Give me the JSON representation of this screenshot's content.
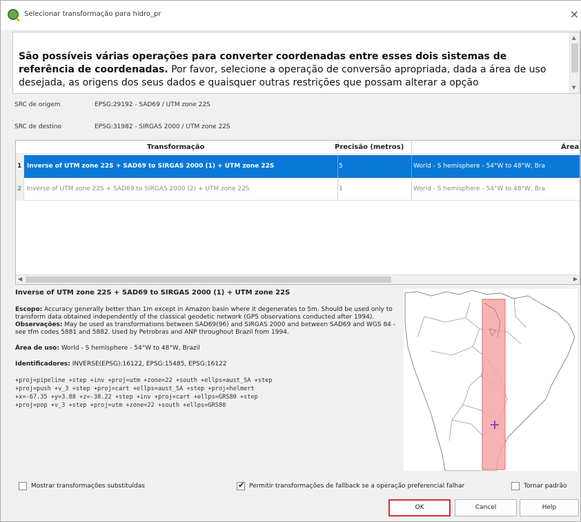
{
  "window": {
    "title": "Selecionar transformação para hidro_pr",
    "close_glyph": "×"
  },
  "message": {
    "bold_text": "São possíveis várias operações para converter coordenadas entre esses dois sistemas de referência de coordenadas.",
    "normal_text": " Por favor, selecione a operação de conversão apropriada, dada a área de uso desejada, as origens dos seus dados e quaisquer outras restrições que possam alterar a opção"
  },
  "src": {
    "origin_label": "SRC de origem",
    "origin_value": "EPSG:29192 - SAD69 / UTM zone 22S",
    "dest_label": "SRC de destino",
    "dest_value": "EPSG:31982 - SIRGAS 2000 / UTM zone 22S"
  },
  "table": {
    "columns": [
      "Transformação",
      "Precisão (metros)",
      "Área"
    ],
    "rows": [
      {
        "num": "1",
        "transformation": "Inverse of UTM zone 22S + SAD69 to SIRGAS 2000 (1) + UTM zone 22S",
        "precision": "5",
        "area": "World - S hemisphere - 54°W to 48°W, Bra"
      },
      {
        "num": "2",
        "transformation": "Inverse of UTM zone 22S + SAD69 to SIRGAS 2000 (2) + UTM zone 22S",
        "precision": "1",
        "area": "World - S hemisphere - 54°W to 48°W, Bra"
      }
    ]
  },
  "details": {
    "title": "Inverse of UTM zone 22S + SAD69 to SIRGAS 2000 (1) + UTM zone 22S",
    "escopo_label": "Escopo:",
    "escopo_text": " Accuracy generally better than 1m except in Amazon basin where it degenerates to 5m. Should be used only to transform data obtained independently of the classical geodetic network (GPS observations conducted after 1994).",
    "obs_label": "Observações:",
    "obs_text": " May be used as transformations between SAD69(96) and SIRGAS 2000 and between SAD69 and WGS 84 - see tfm codes 5881 and 5882. Used by Petrobras and ANP throughout Brazil from 1994.",
    "area_label": "Área de uso:",
    "area_text": " World - S hemisphere - 54°W to 48°W, Brazil",
    "ids_label": "Identificadores:",
    "ids_text": " INVERSE(EPSG):16122, EPSG:15485, EPSG:16122",
    "proj_lines": [
      "+proj=pipeline +step +inv +proj=utm +zone=22 +south +ellps=aust_SA +step",
      "+proj=push +v_3 +step +proj=cart +ellps=aust_SA +step +proj=helmert",
      "+x=-67.35 +y=3.88 +z=-38.22 +step +inv +proj=cart +ellps=GRS80 +step",
      "+proj=pop +v_3 +step +proj=utm +zone=22 +south +ellps=GRS80"
    ]
  },
  "options": {
    "show_superseded": "Mostrar transformações substituídas",
    "allow_fallback": "Permitir transformações de fallback se a operação preferencial falhar",
    "make_default": "Tornar padrão",
    "allow_fallback_checked": true
  },
  "buttons": {
    "ok": "OK",
    "cancel": "Cancel",
    "help": "Help"
  },
  "colors": {
    "selection": "#0a78d7",
    "ok_highlight": "#d62b38",
    "area_fill": "#f4a6a6"
  }
}
